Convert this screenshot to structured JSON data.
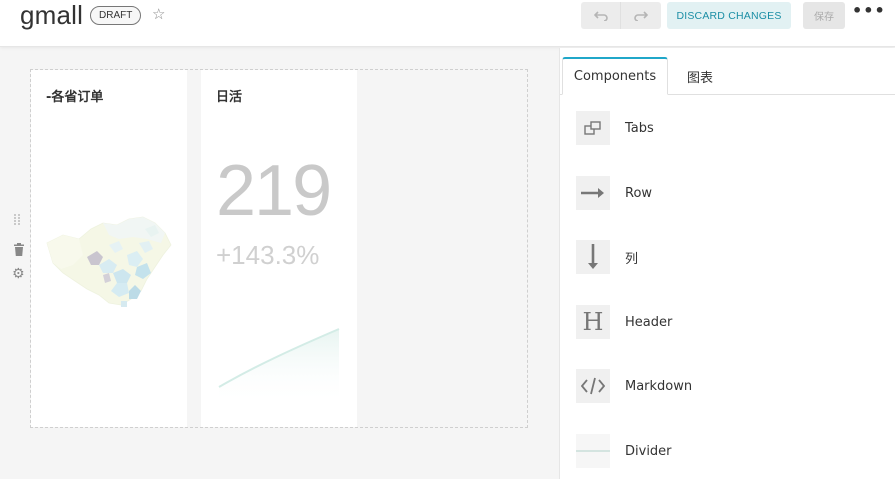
{
  "header": {
    "title": "gmall",
    "badge": "DRAFT",
    "discard_label": "DISCARD CHANGES",
    "save_label": "保存",
    "more_label": "•••"
  },
  "charts": [
    {
      "title": "-各省订单"
    },
    {
      "title": "日活",
      "big_number": "219",
      "change": "+143.3%"
    }
  ],
  "panel": {
    "tabs": [
      {
        "label": "Components",
        "active": true
      },
      {
        "label": "图表",
        "active": false
      }
    ],
    "components": [
      {
        "label": "Tabs",
        "icon": "tabs-icon"
      },
      {
        "label": "Row",
        "icon": "row-arrow-icon"
      },
      {
        "label": "列",
        "icon": "column-arrow-icon"
      },
      {
        "label": "Header",
        "icon": "header-icon"
      },
      {
        "label": "Markdown",
        "icon": "markdown-code-icon"
      },
      {
        "label": "Divider",
        "icon": "divider-icon"
      }
    ]
  },
  "colors": {
    "accent": "#20a7c9",
    "discard_bg": "#e2f1f3",
    "discard_text": "#1b8ea5"
  }
}
